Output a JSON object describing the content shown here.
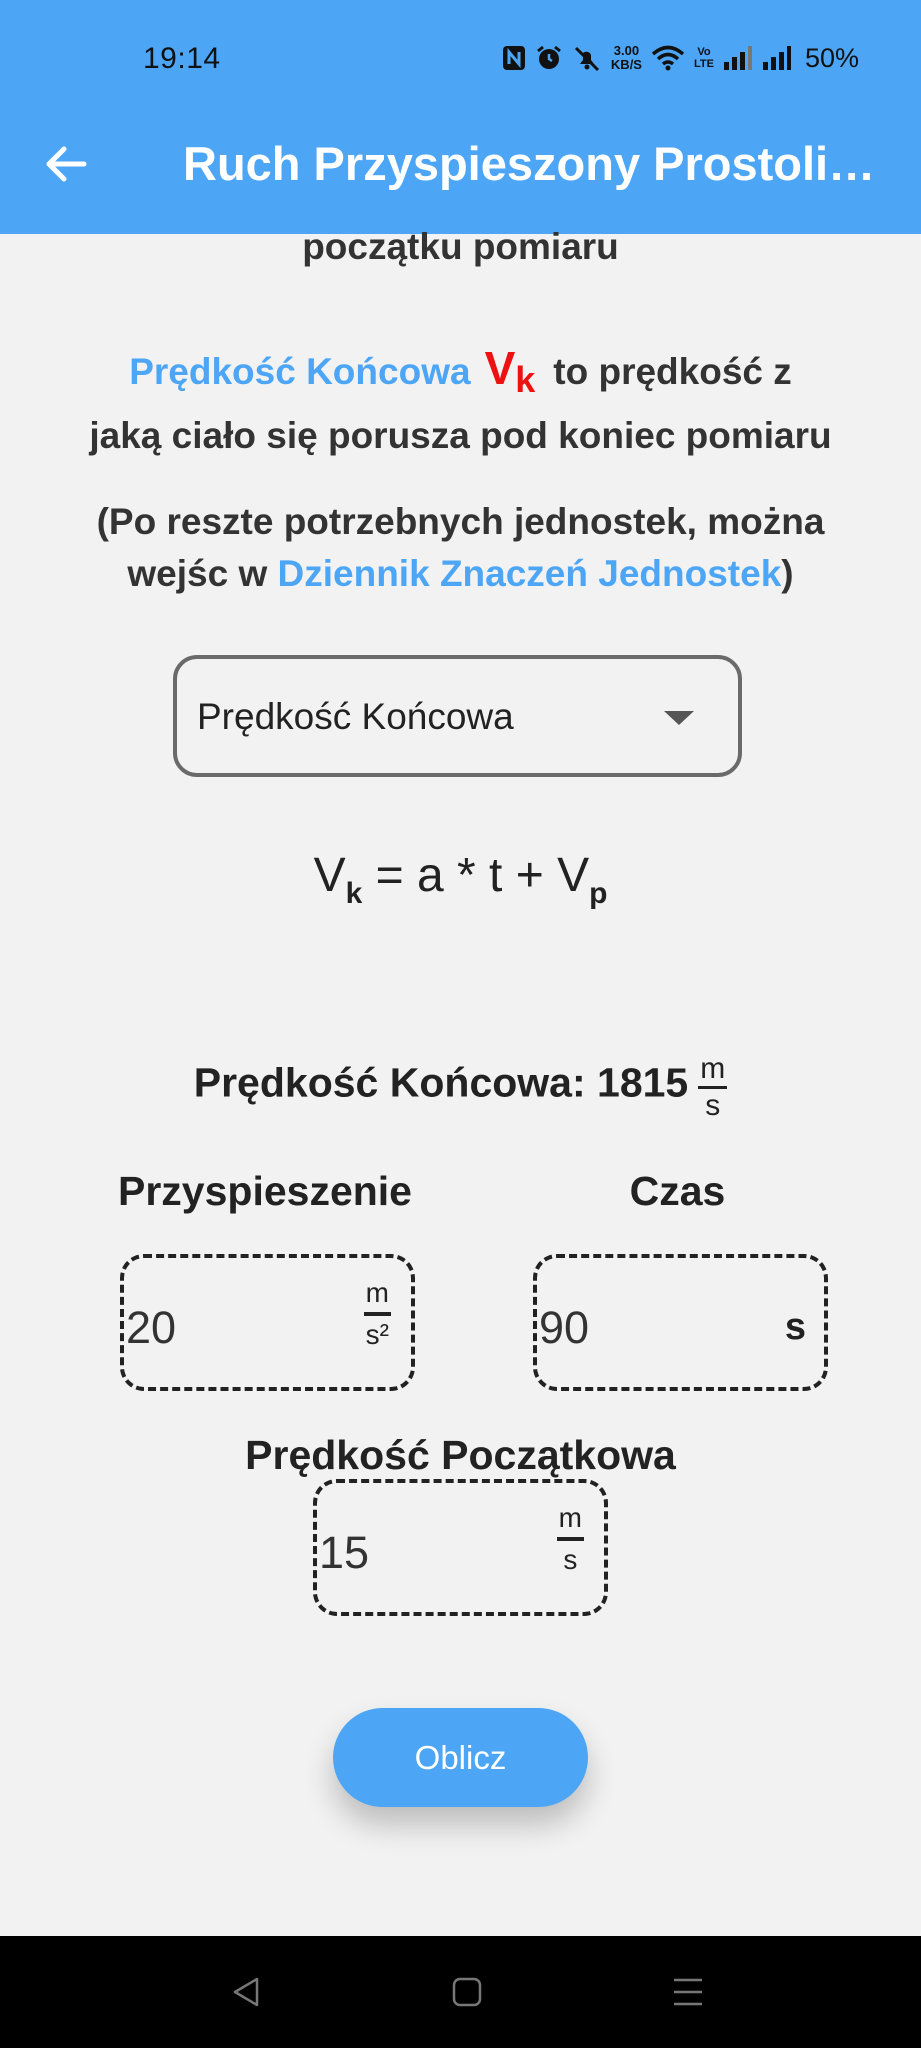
{
  "status_bar": {
    "time": "19:14",
    "net_speed_value": "3.00",
    "net_speed_unit": "KB/S",
    "volte_top": "Vo",
    "volte_bottom": "LTE",
    "battery": "50%",
    "icons": [
      "nfc-icon",
      "alarm-icon",
      "mute-icon",
      "wifi-icon",
      "signal-icon",
      "signal-icon",
      "battery"
    ]
  },
  "app_bar": {
    "title": "Ruch Przyspieszony Prostoliniowy",
    "back_icon": "arrow-left-icon"
  },
  "content": {
    "cut_line": "początku pomiaru",
    "definition": {
      "term": "Prędkość Końcowa",
      "symbol": "V",
      "symbol_sub": "k",
      "text_line1": "to prędkość z",
      "text_line2": "jaką ciało się porusza pod koniec pomiaru"
    },
    "note": {
      "line1": "(Po reszte potrzebnych jednostek, można",
      "line2_prefix": "wejśc w ",
      "link": "Dziennik Znaczeń Jednostek",
      "line2_suffix": ")"
    },
    "dropdown": {
      "selected": "Prędkość Końcowa"
    },
    "formula": {
      "v": "V",
      "v_sub": "k",
      "middle": " = a * t + ",
      "v2": "V",
      "v2_sub": "p"
    },
    "result": {
      "label": "Prędkość Końcowa: 1815",
      "unit_num": "m",
      "unit_den": "s"
    },
    "fields": {
      "acceleration": {
        "label": "Przyspieszenie",
        "value": "20",
        "unit_num": "m",
        "unit_den": "s²"
      },
      "time": {
        "label": "Czas",
        "value": "90",
        "unit": "s"
      },
      "initial_velocity": {
        "label": "Prędkość Początkowa",
        "value": "15",
        "unit_num": "m",
        "unit_den": "s"
      }
    },
    "button": {
      "label": "Oblicz"
    }
  },
  "colors": {
    "accent": "#4da6f5",
    "symbol_red": "#ee1111",
    "background": "#f2f2f2",
    "nav_bar": "#000000"
  }
}
